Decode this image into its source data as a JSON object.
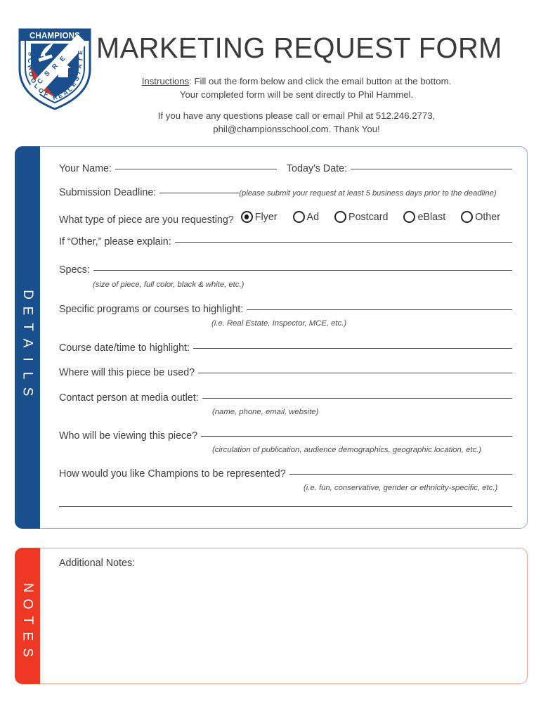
{
  "header": {
    "title": "MARKETING REQUEST FORM",
    "logo": {
      "name": "champions-school-of-real-estate-logo",
      "top_banner": "CHAMPIONS",
      "arc_left": "SCHOOL OF",
      "arc_right": "REAL ESTATE",
      "stripe_letters": "C S R E",
      "colors": {
        "blue": "#1a4f8e",
        "red": "#e03a2f"
      }
    },
    "instructions_label": "Instructions",
    "instructions_line1": ": Fill out the form below and click the email button at the bottom.",
    "instructions_line2": "Your completed form will be sent directly to Phil Hammel.",
    "contact_line1": "If you have any questions please call or email Phil at 512.246.2773,",
    "contact_line2": "phil@championsschool.com. Thank You!"
  },
  "details": {
    "tab_label": "DETAILS",
    "tab_color": "#1a4f8e",
    "fields": {
      "your_name": "Your Name:",
      "todays_date": "Today's Date:",
      "submission_deadline": "Submission Deadline:",
      "submission_hint": "(please submit your request at least 5 business days prior to the deadline)",
      "piece_type_question": "What type of piece are you requesting?",
      "other_explain": "If “Other,” please explain:",
      "specs": "Specs:",
      "specs_hint": "(size of piece, full color, black & white, etc.)",
      "programs": "Specific programs or courses to highlight:",
      "programs_hint": "(i.e. Real Estate, Inspector, MCE, etc.)",
      "course_datetime": "Course date/time to highlight:",
      "where_used": "Where will this piece be used?",
      "contact_person": "Contact person at media outlet:",
      "contact_hint": "(name, phone, email, website)",
      "who_viewing": "Who will be viewing this piece?",
      "who_hint": "(circulation of publication, audience demographics, geographic location, etc.)",
      "represented": "How would you like Champions to be represented?",
      "represented_hint": "(i.e. fun, conservative, gender or ethnicity-specific, etc.)"
    },
    "piece_type_options": [
      {
        "label": "Flyer",
        "selected": true
      },
      {
        "label": "Ad",
        "selected": false
      },
      {
        "label": "Postcard",
        "selected": false
      },
      {
        "label": "eBlast",
        "selected": false
      },
      {
        "label": "Other",
        "selected": false
      }
    ]
  },
  "notes": {
    "tab_label": "NOTES",
    "tab_color": "#ee3824",
    "title": "Additional Notes:"
  }
}
